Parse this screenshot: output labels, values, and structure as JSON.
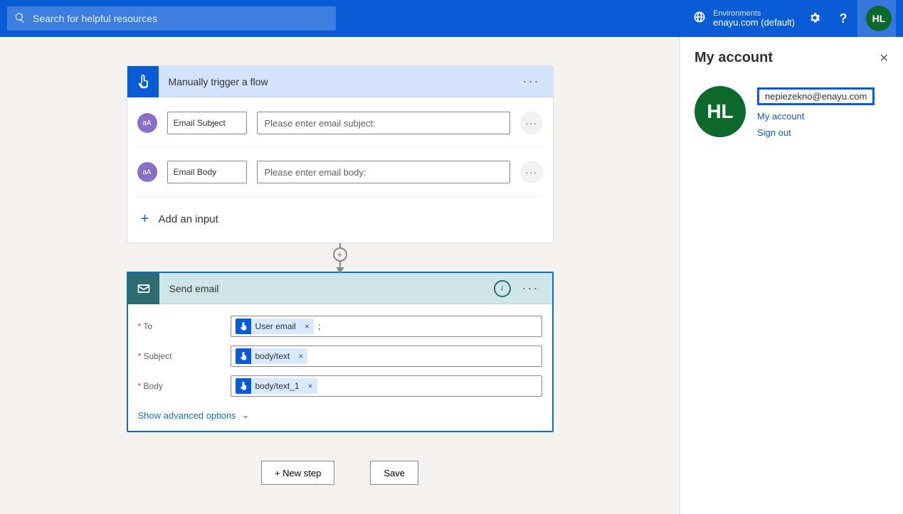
{
  "header": {
    "search_placeholder": "Search for helpful resources",
    "env_label": "Environments",
    "env_value": "enayu.com (default)",
    "avatar_initials": "HL"
  },
  "trigger": {
    "title": "Manually trigger a flow",
    "params": [
      {
        "name": "Email Subject",
        "placeholder": "Please enter email subject:"
      },
      {
        "name": "Email Body",
        "placeholder": "Please enter email body:"
      }
    ],
    "add_label": "Add an input"
  },
  "action": {
    "title": "Send email",
    "fields": {
      "to_label": "* To",
      "to_token": "User email",
      "subject_label": "* Subject",
      "subject_token": "body/text",
      "body_label": "* Body",
      "body_token": "body/text_1"
    },
    "advanced": "Show advanced options"
  },
  "buttons": {
    "new_step": "+ New step",
    "save": "Save"
  },
  "panel": {
    "title": "My account",
    "avatar_initials": "HL",
    "email": "nepiezekno@enayu.com",
    "link_account": "My account",
    "link_signout": "Sign out"
  }
}
